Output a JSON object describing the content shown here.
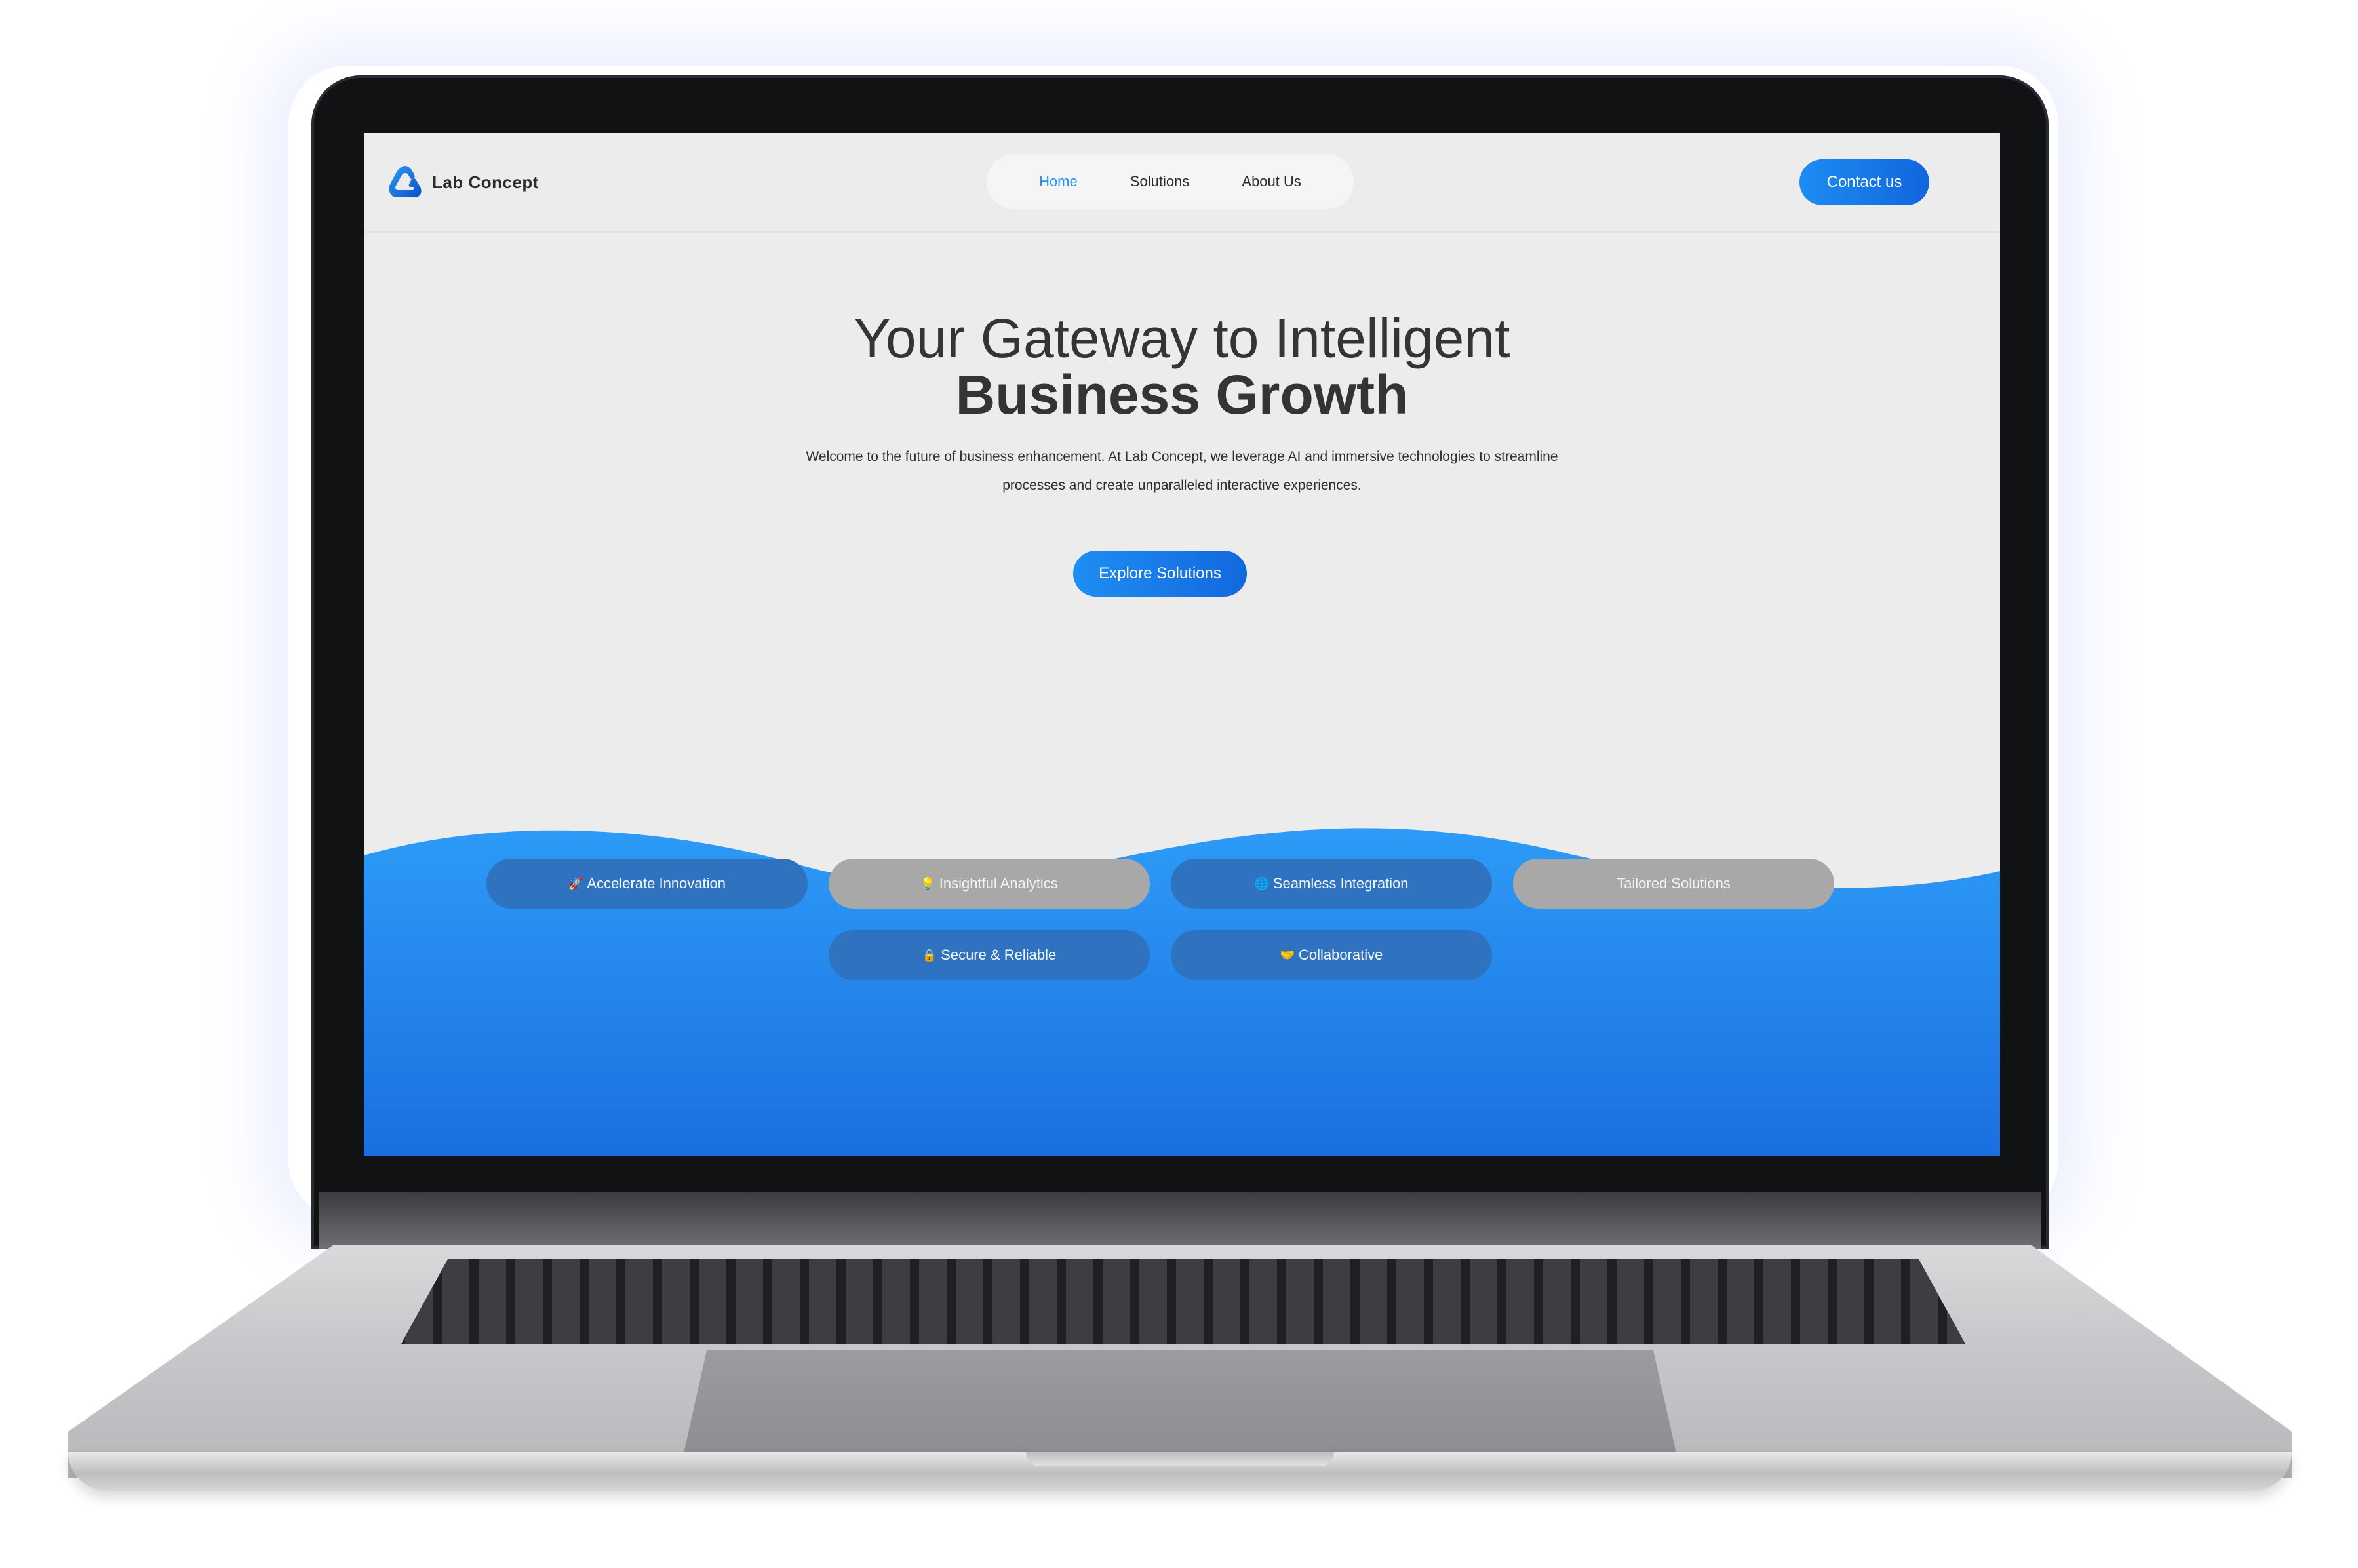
{
  "brand": {
    "name": "Lab Concept",
    "logo_icon": "lab-concept-logo-icon",
    "color": "#1a6fe0"
  },
  "nav": {
    "links": [
      {
        "label": "Home",
        "active": true
      },
      {
        "label": "Solutions",
        "active": false
      },
      {
        "label": "About Us",
        "active": false
      }
    ],
    "contact_label": "Contact us"
  },
  "hero": {
    "title_line1": "Your Gateway to Intelligent",
    "title_line2": "Business Growth",
    "subtitle_line1": "Welcome to the future of business enhancement. At Lab Concept, we leverage AI and immersive technologies to streamline",
    "subtitle_line2": "processes and create unparalleled interactive experiences.",
    "cta_label": "Explore Solutions"
  },
  "features": [
    {
      "icon": "🚀",
      "icon_name": "rocket-icon",
      "label": "Accelerate Innovation"
    },
    {
      "icon": "💡",
      "icon_name": "lightbulb-icon",
      "label": "Insightful Analytics"
    },
    {
      "icon": "🌐",
      "icon_name": "globe-icon",
      "label": "Seamless Integration"
    },
    {
      "icon": "",
      "icon_name": "",
      "label": "Tailored Solutions"
    },
    {
      "icon": "🔒",
      "icon_name": "lock-icon",
      "label": "Secure & Reliable"
    },
    {
      "icon": "🤝",
      "icon_name": "handshake-icon",
      "label": "Collaborative"
    }
  ],
  "colors": {
    "accent": "#1d8cf2",
    "wave_top": "#2d9bf7",
    "wave_bottom": "#1a6fe0",
    "background": "#ececec"
  }
}
